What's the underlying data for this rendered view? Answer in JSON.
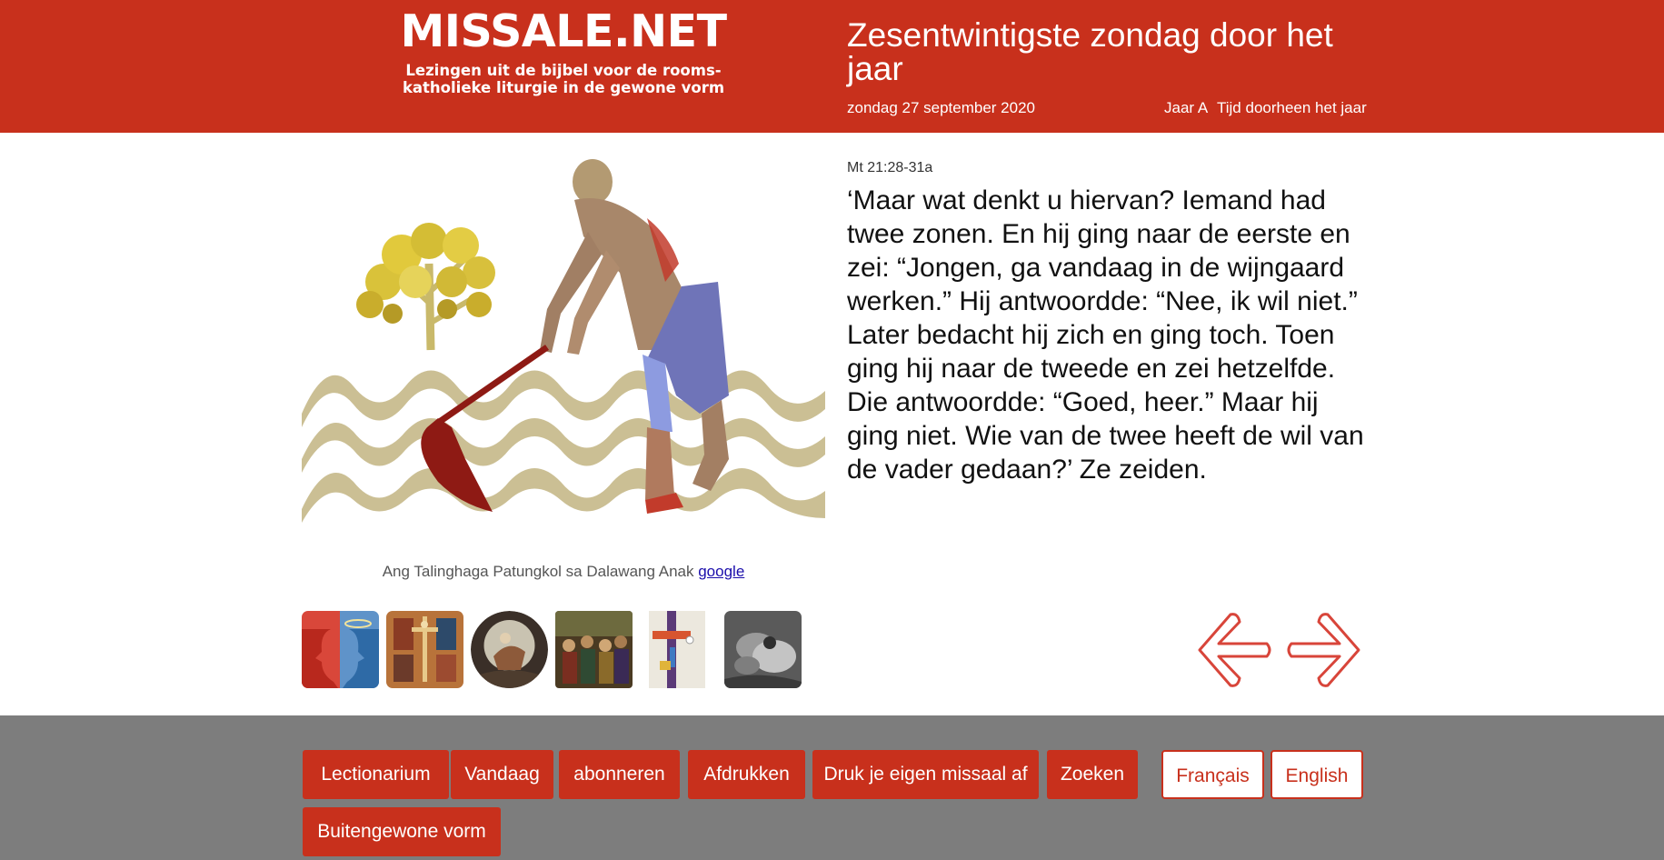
{
  "site": {
    "title": "MISSALE.NET",
    "subtitle": "Lezingen uit de bijbel voor de rooms-katholieke liturgie in de gewone vorm"
  },
  "day": {
    "title": "Zesentwintigste zondag door het jaar",
    "date": "zondag 27 september 2020",
    "year": "Jaar A",
    "season": "Tijd doorheen het jaar"
  },
  "image": {
    "caption": "Ang Talinghaga Patungkol sa Dalawang Anak",
    "link_label": "google"
  },
  "reading": {
    "reference": "Mt 21:28-31a",
    "text": "‘Maar wat denkt u hiervan? Iemand had twee zonen. En hij ging naar de eerste en zei: “Jongen, ga vandaag in de wijngaard werken.” Hij antwoordde: “Nee, ik wil niet.” Later bedacht hij zich en ging toch. Toen ging hij naar de tweede en zei hetzelfde. Die antwoordde: “Goed, heer.” Maar hij ging niet. Wie van de twee heeft de wil van de vader gedaan?’ Ze zeiden."
  },
  "thumbnails": [
    {
      "name": "thumbnail-two-faces"
    },
    {
      "name": "thumbnail-crucifixion-altarpiece"
    },
    {
      "name": "thumbnail-round-painting"
    },
    {
      "name": "thumbnail-crowd-painting"
    },
    {
      "name": "thumbnail-colored-cross"
    },
    {
      "name": "thumbnail-bw-photo"
    }
  ],
  "navigation": {
    "prev_icon": "arrow-left-icon",
    "next_icon": "arrow-right-icon"
  },
  "footer": {
    "buttons": [
      "Lectionarium",
      "Vandaag",
      "abonneren",
      "Afdrukken",
      "Druk je eigen missaal af",
      "Zoeken",
      "Buitengewone vorm"
    ],
    "languages": [
      "Français",
      "English"
    ]
  },
  "colors": {
    "brand_red": "#c8301c",
    "footer_gray": "#7d7d7d",
    "link_blue": "#1a0dab"
  }
}
